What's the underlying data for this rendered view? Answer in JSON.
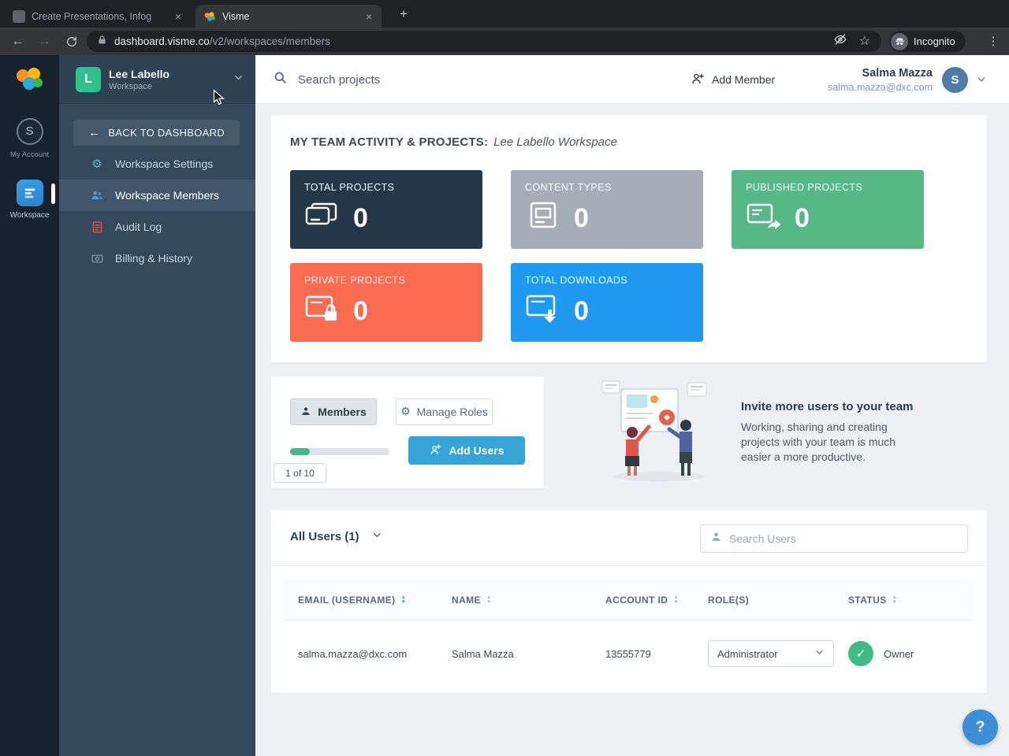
{
  "icons": {
    "close": "×",
    "new_tab": "+",
    "menu": "⋮",
    "star": "☆",
    "help": "?",
    "gear": "⚙",
    "check": "✓",
    "sort_up": "▲",
    "sort_down": "▼",
    "back_arrow": "←",
    "forward_arrow": "→"
  },
  "colors": {
    "accent": "#35a4d7",
    "success": "#3fbb87",
    "help_blue": "#3d8fd8",
    "progress_green": "#41ba88"
  },
  "browser": {
    "tabs": [
      {
        "title": "Create Presentations, Infog",
        "active": false
      },
      {
        "title": "Visme",
        "active": true
      }
    ],
    "url_domain": "dashboard.visme.co",
    "url_path": "/v2/workspaces/members",
    "incognito_label": "Incognito"
  },
  "rail": {
    "my_account_label": "My Account",
    "my_account_letter": "S",
    "workspace_label": "Workspace"
  },
  "sidebar": {
    "workspace_name": "Lee Labello",
    "workspace_sublabel": "Workspace",
    "workspace_letter": "L",
    "back_button": "BACK TO DASHBOARD",
    "items": [
      {
        "label": "Workspace Settings",
        "icon": "gear",
        "active": false
      },
      {
        "label": "Workspace Members",
        "icon": "users",
        "active": true
      },
      {
        "label": "Audit Log",
        "icon": "audit-log",
        "active": false
      },
      {
        "label": "Billing & History",
        "icon": "billing",
        "active": false
      }
    ]
  },
  "topbar": {
    "search_placeholder": "Search projects",
    "add_member_label": "Add Member",
    "user_name": "Salma Mazza",
    "user_email": "salma.mazza@dxc.com",
    "user_avatar_letter": "S"
  },
  "activity": {
    "title": "MY TEAM ACTIVITY & PROJECTS:",
    "workspace_name": "Lee Labello Workspace",
    "stats": [
      {
        "label": "TOTAL PROJECTS",
        "value": "0",
        "color": "#253849",
        "icon": "projects-stack"
      },
      {
        "label": "CONTENT TYPES",
        "value": "0",
        "color": "#a5aeb8",
        "icon": "content-window"
      },
      {
        "label": "PUBLISHED PROJECTS",
        "value": "0",
        "color": "#56b787",
        "icon": "publish-share"
      },
      {
        "label": "PRIVATE PROJECTS",
        "value": "0",
        "color": "#f96c4f",
        "icon": "private-lock"
      },
      {
        "label": "TOTAL DOWNLOADS",
        "value": "0",
        "color": "#1e9bf0",
        "icon": "download-arrow"
      }
    ]
  },
  "members_panel": {
    "members_tab": "Members",
    "manage_roles_tab": "Manage Roles",
    "quota": "1 of 10",
    "add_users_label": "Add Users",
    "invite_heading": "Invite more users to your team",
    "invite_body": "Working, sharing and creating projects with your team is much easier a more productive."
  },
  "users_panel": {
    "filter_label": "All Users (1)",
    "search_placeholder": "Search Users",
    "table": {
      "columns": [
        "EMAIL (USERNAME)",
        "NAME",
        "ACCOUNT ID",
        "ROLE(S)",
        "STATUS"
      ],
      "rows": [
        {
          "email": "salma.mazza@dxc.com",
          "name": "Salma Mazza",
          "account_id": "13555779",
          "role": "Administrator",
          "status": "Owner"
        }
      ]
    }
  }
}
